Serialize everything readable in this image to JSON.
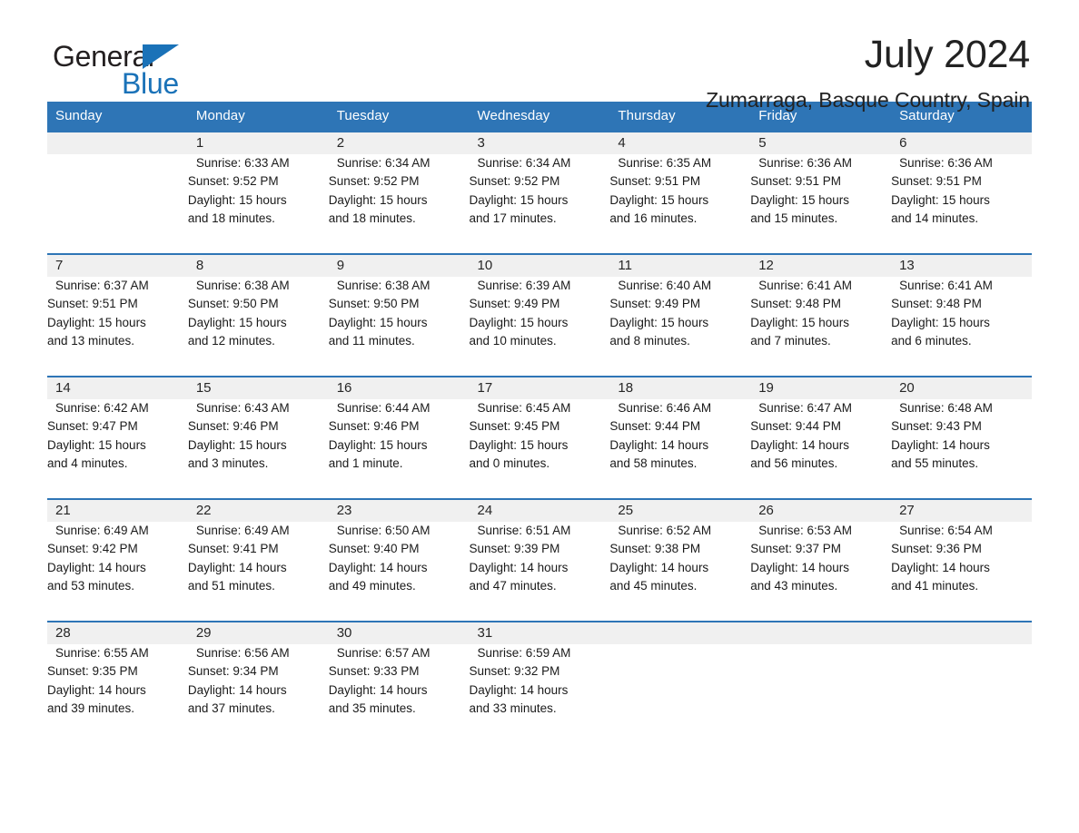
{
  "brand": {
    "name_part1": "General",
    "name_part2": "Blue",
    "logo_icon": "triangle-flag-icon",
    "accent_color": "#1a72b8"
  },
  "header": {
    "month_title": "July 2024",
    "location": "Zumarraga, Basque Country, Spain"
  },
  "theme": {
    "header_row_color": "#2e75b6",
    "week_divider_color": "#2e75b6",
    "daynum_band_color": "#f0f0f0",
    "page_background": "#ffffff"
  },
  "calendar": {
    "weekday_headers": [
      "Sunday",
      "Monday",
      "Tuesday",
      "Wednesday",
      "Thursday",
      "Friday",
      "Saturday"
    ],
    "weeks": [
      [
        {
          "day": "",
          "info": "",
          "empty": true
        },
        {
          "day": "1",
          "info": "Sunrise: 6:33 AM\nSunset: 9:52 PM\nDaylight: 15 hours\nand 18 minutes."
        },
        {
          "day": "2",
          "info": "Sunrise: 6:34 AM\nSunset: 9:52 PM\nDaylight: 15 hours\nand 18 minutes."
        },
        {
          "day": "3",
          "info": "Sunrise: 6:34 AM\nSunset: 9:52 PM\nDaylight: 15 hours\nand 17 minutes."
        },
        {
          "day": "4",
          "info": "Sunrise: 6:35 AM\nSunset: 9:51 PM\nDaylight: 15 hours\nand 16 minutes."
        },
        {
          "day": "5",
          "info": "Sunrise: 6:36 AM\nSunset: 9:51 PM\nDaylight: 15 hours\nand 15 minutes."
        },
        {
          "day": "6",
          "info": "Sunrise: 6:36 AM\nSunset: 9:51 PM\nDaylight: 15 hours\nand 14 minutes."
        }
      ],
      [
        {
          "day": "7",
          "info": "Sunrise: 6:37 AM\nSunset: 9:51 PM\nDaylight: 15 hours\nand 13 minutes."
        },
        {
          "day": "8",
          "info": "Sunrise: 6:38 AM\nSunset: 9:50 PM\nDaylight: 15 hours\nand 12 minutes."
        },
        {
          "day": "9",
          "info": "Sunrise: 6:38 AM\nSunset: 9:50 PM\nDaylight: 15 hours\nand 11 minutes."
        },
        {
          "day": "10",
          "info": "Sunrise: 6:39 AM\nSunset: 9:49 PM\nDaylight: 15 hours\nand 10 minutes."
        },
        {
          "day": "11",
          "info": "Sunrise: 6:40 AM\nSunset: 9:49 PM\nDaylight: 15 hours\nand 8 minutes."
        },
        {
          "day": "12",
          "info": "Sunrise: 6:41 AM\nSunset: 9:48 PM\nDaylight: 15 hours\nand 7 minutes."
        },
        {
          "day": "13",
          "info": "Sunrise: 6:41 AM\nSunset: 9:48 PM\nDaylight: 15 hours\nand 6 minutes."
        }
      ],
      [
        {
          "day": "14",
          "info": "Sunrise: 6:42 AM\nSunset: 9:47 PM\nDaylight: 15 hours\nand 4 minutes."
        },
        {
          "day": "15",
          "info": "Sunrise: 6:43 AM\nSunset: 9:46 PM\nDaylight: 15 hours\nand 3 minutes."
        },
        {
          "day": "16",
          "info": "Sunrise: 6:44 AM\nSunset: 9:46 PM\nDaylight: 15 hours\nand 1 minute."
        },
        {
          "day": "17",
          "info": "Sunrise: 6:45 AM\nSunset: 9:45 PM\nDaylight: 15 hours\nand 0 minutes."
        },
        {
          "day": "18",
          "info": "Sunrise: 6:46 AM\nSunset: 9:44 PM\nDaylight: 14 hours\nand 58 minutes."
        },
        {
          "day": "19",
          "info": "Sunrise: 6:47 AM\nSunset: 9:44 PM\nDaylight: 14 hours\nand 56 minutes."
        },
        {
          "day": "20",
          "info": "Sunrise: 6:48 AM\nSunset: 9:43 PM\nDaylight: 14 hours\nand 55 minutes."
        }
      ],
      [
        {
          "day": "21",
          "info": "Sunrise: 6:49 AM\nSunset: 9:42 PM\nDaylight: 14 hours\nand 53 minutes."
        },
        {
          "day": "22",
          "info": "Sunrise: 6:49 AM\nSunset: 9:41 PM\nDaylight: 14 hours\nand 51 minutes."
        },
        {
          "day": "23",
          "info": "Sunrise: 6:50 AM\nSunset: 9:40 PM\nDaylight: 14 hours\nand 49 minutes."
        },
        {
          "day": "24",
          "info": "Sunrise: 6:51 AM\nSunset: 9:39 PM\nDaylight: 14 hours\nand 47 minutes."
        },
        {
          "day": "25",
          "info": "Sunrise: 6:52 AM\nSunset: 9:38 PM\nDaylight: 14 hours\nand 45 minutes."
        },
        {
          "day": "26",
          "info": "Sunrise: 6:53 AM\nSunset: 9:37 PM\nDaylight: 14 hours\nand 43 minutes."
        },
        {
          "day": "27",
          "info": "Sunrise: 6:54 AM\nSunset: 9:36 PM\nDaylight: 14 hours\nand 41 minutes."
        }
      ],
      [
        {
          "day": "28",
          "info": "Sunrise: 6:55 AM\nSunset: 9:35 PM\nDaylight: 14 hours\nand 39 minutes."
        },
        {
          "day": "29",
          "info": "Sunrise: 6:56 AM\nSunset: 9:34 PM\nDaylight: 14 hours\nand 37 minutes."
        },
        {
          "day": "30",
          "info": "Sunrise: 6:57 AM\nSunset: 9:33 PM\nDaylight: 14 hours\nand 35 minutes."
        },
        {
          "day": "31",
          "info": "Sunrise: 6:59 AM\nSunset: 9:32 PM\nDaylight: 14 hours\nand 33 minutes."
        },
        {
          "day": "",
          "info": "",
          "empty": true
        },
        {
          "day": "",
          "info": "",
          "empty": true
        },
        {
          "day": "",
          "info": "",
          "empty": true
        }
      ]
    ]
  }
}
